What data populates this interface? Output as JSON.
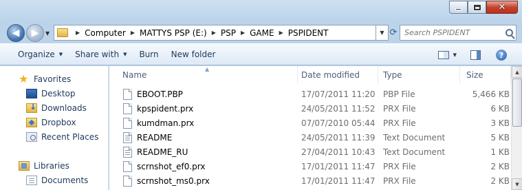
{
  "window": {
    "caption_buttons": {
      "minimize_icon": "minimize-icon",
      "maximize_icon": "maximize-icon",
      "close_glyph": "✕"
    }
  },
  "address": {
    "breadcrumb": [
      "Computer",
      "MATTYS PSP (E:)",
      "PSP",
      "GAME",
      "PSPIDENT"
    ],
    "search_placeholder": "Search PSPIDENT"
  },
  "toolbar": {
    "organize": "Organize",
    "share_with": "Share with",
    "burn": "Burn",
    "new_folder": "New folder"
  },
  "navpane": {
    "favorites_label": "Favorites",
    "favorites": [
      "Desktop",
      "Downloads",
      "Dropbox",
      "Recent Places"
    ],
    "libraries_label": "Libraries",
    "libraries": [
      "Documents"
    ]
  },
  "columns": {
    "name": "Name",
    "date": "Date modified",
    "type": "Type",
    "size": "Size"
  },
  "files": [
    {
      "name": "EBOOT.PBP",
      "date": "17/07/2011 11:20",
      "type": "PBP File",
      "size": "5,466 KB",
      "icon": "file"
    },
    {
      "name": "kpspident.prx",
      "date": "24/05/2011 11:52",
      "type": "PRX File",
      "size": "6 KB",
      "icon": "file"
    },
    {
      "name": "kumdman.prx",
      "date": "07/07/2010 05:44",
      "type": "PRX File",
      "size": "3 KB",
      "icon": "file"
    },
    {
      "name": "README",
      "date": "24/05/2011 11:39",
      "type": "Text Document",
      "size": "5 KB",
      "icon": "text"
    },
    {
      "name": "README_RU",
      "date": "27/04/2011 10:43",
      "type": "Text Document",
      "size": "1 KB",
      "icon": "text"
    },
    {
      "name": "scrnshot_ef0.prx",
      "date": "17/01/2011 11:47",
      "type": "PRX File",
      "size": "2 KB",
      "icon": "file"
    },
    {
      "name": "scrnshot_ms0.prx",
      "date": "17/01/2011 11:47",
      "type": "PRX File",
      "size": "2 KB",
      "icon": "file"
    }
  ]
}
